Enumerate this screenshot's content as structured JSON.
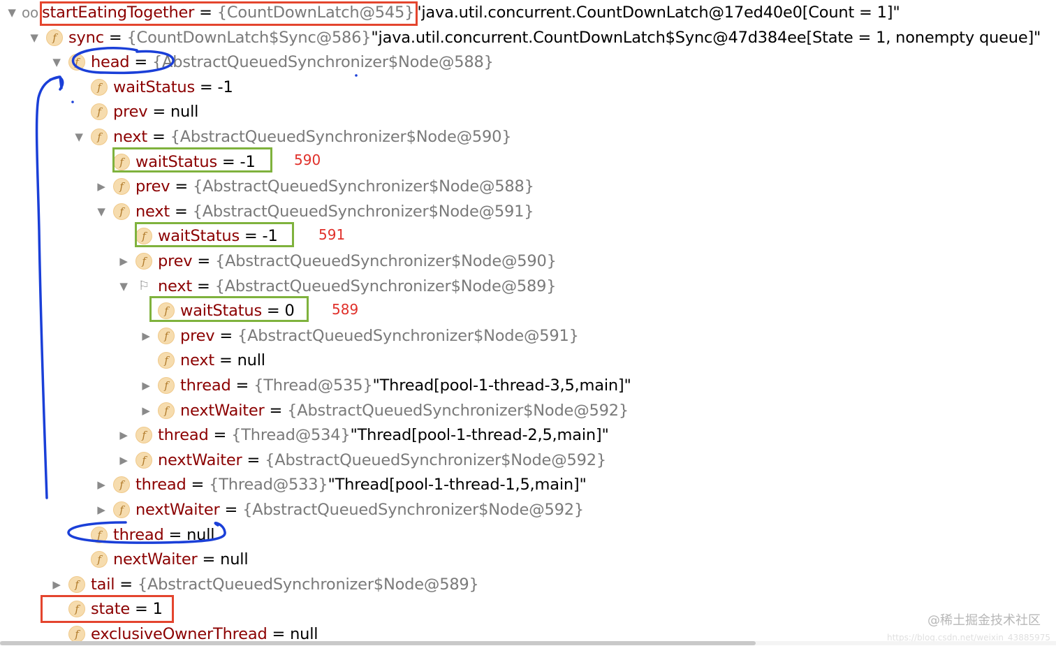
{
  "rows": [
    {
      "arrow": "expanded",
      "icon": "watch-icon",
      "name": "startEatingTogether",
      "ref": "{CountDownLatch@545}",
      "value": "\"java.util.concurrent.CountDownLatch@17ed40e0[Count = 1]\""
    },
    {
      "arrow": "expanded",
      "icon": "field-icon",
      "name": "sync",
      "ref": "{CountDownLatch$Sync@586}",
      "value": "\"java.util.concurrent.CountDownLatch$Sync@47d384ee[State = 1, nonempty queue]\""
    },
    {
      "arrow": "expanded",
      "icon": "field-icon",
      "name": "head",
      "ref": "{AbstractQueuedSynchronizer$Node@588}",
      "value": ""
    },
    {
      "arrow": "none",
      "icon": "field-icon",
      "name": "waitStatus",
      "ref": "",
      "value": "-1"
    },
    {
      "arrow": "none",
      "icon": "field-icon",
      "name": "prev",
      "ref": "",
      "value": "null"
    },
    {
      "arrow": "expanded",
      "icon": "field-icon",
      "name": "next",
      "ref": "{AbstractQueuedSynchronizer$Node@590}",
      "value": ""
    },
    {
      "arrow": "none",
      "icon": "field-icon",
      "name": "waitStatus",
      "ref": "",
      "value": "-1"
    },
    {
      "arrow": "collapsed",
      "icon": "field-icon",
      "name": "prev",
      "ref": "{AbstractQueuedSynchronizer$Node@588}",
      "value": ""
    },
    {
      "arrow": "expanded",
      "icon": "field-icon",
      "name": "next",
      "ref": "{AbstractQueuedSynchronizer$Node@591}",
      "value": ""
    },
    {
      "arrow": "none",
      "icon": "field-icon",
      "name": "waitStatus",
      "ref": "",
      "value": "-1"
    },
    {
      "arrow": "collapsed",
      "icon": "field-icon",
      "name": "prev",
      "ref": "{AbstractQueuedSynchronizer$Node@590}",
      "value": ""
    },
    {
      "arrow": "expanded",
      "icon": "flag-icon",
      "name": "next",
      "ref": "{AbstractQueuedSynchronizer$Node@589}",
      "value": ""
    },
    {
      "arrow": "none",
      "icon": "field-icon",
      "name": "waitStatus",
      "ref": "",
      "value": "0"
    },
    {
      "arrow": "collapsed",
      "icon": "field-icon",
      "name": "prev",
      "ref": "{AbstractQueuedSynchronizer$Node@591}",
      "value": ""
    },
    {
      "arrow": "none",
      "icon": "field-icon",
      "name": "next",
      "ref": "",
      "value": "null"
    },
    {
      "arrow": "collapsed",
      "icon": "field-icon",
      "name": "thread",
      "ref": "{Thread@535}",
      "value": "\"Thread[pool-1-thread-3,5,main]\""
    },
    {
      "arrow": "collapsed",
      "icon": "field-icon",
      "name": "nextWaiter",
      "ref": "{AbstractQueuedSynchronizer$Node@592}",
      "value": ""
    },
    {
      "arrow": "collapsed",
      "icon": "field-icon",
      "name": "thread",
      "ref": "{Thread@534}",
      "value": "\"Thread[pool-1-thread-2,5,main]\""
    },
    {
      "arrow": "collapsed",
      "icon": "field-icon",
      "name": "nextWaiter",
      "ref": "{AbstractQueuedSynchronizer$Node@592}",
      "value": ""
    },
    {
      "arrow": "collapsed",
      "icon": "field-icon",
      "name": "thread",
      "ref": "{Thread@533}",
      "value": "\"Thread[pool-1-thread-1,5,main]\""
    },
    {
      "arrow": "collapsed",
      "icon": "field-icon",
      "name": "nextWaiter",
      "ref": "{AbstractQueuedSynchronizer$Node@592}",
      "value": ""
    },
    {
      "arrow": "none",
      "icon": "field-icon",
      "name": "thread",
      "ref": "",
      "value": "null"
    },
    {
      "arrow": "none",
      "icon": "field-icon",
      "name": "nextWaiter",
      "ref": "",
      "value": "null"
    },
    {
      "arrow": "collapsed",
      "icon": "field-icon",
      "name": "tail",
      "ref": "{AbstractQueuedSynchronizer$Node@589}",
      "value": ""
    },
    {
      "arrow": "none",
      "icon": "field-icon",
      "name": "state",
      "ref": "",
      "value": "1"
    },
    {
      "arrow": "none",
      "icon": "field-icon",
      "name": "exclusiveOwnerThread",
      "ref": "",
      "value": "null"
    }
  ],
  "annotations": {
    "node_590": "590",
    "node_591": "591",
    "node_589": "589"
  },
  "icon_glyphs": {
    "field": "f",
    "watch": "oo",
    "flag": "⚐"
  },
  "watermark": {
    "text": "@稀土掘金技术社区",
    "url": "https://blog.csdn.net/weixin_43885975"
  },
  "colors": {
    "field_name": "#8b0000",
    "reference": "#7a7a7a",
    "value": "#000000",
    "annotation": "#e0302a",
    "red_box": "#e4452e",
    "green_box": "#7fb23d",
    "ink": "#1a3fd8",
    "field_icon_bg": "#f6dcae"
  }
}
